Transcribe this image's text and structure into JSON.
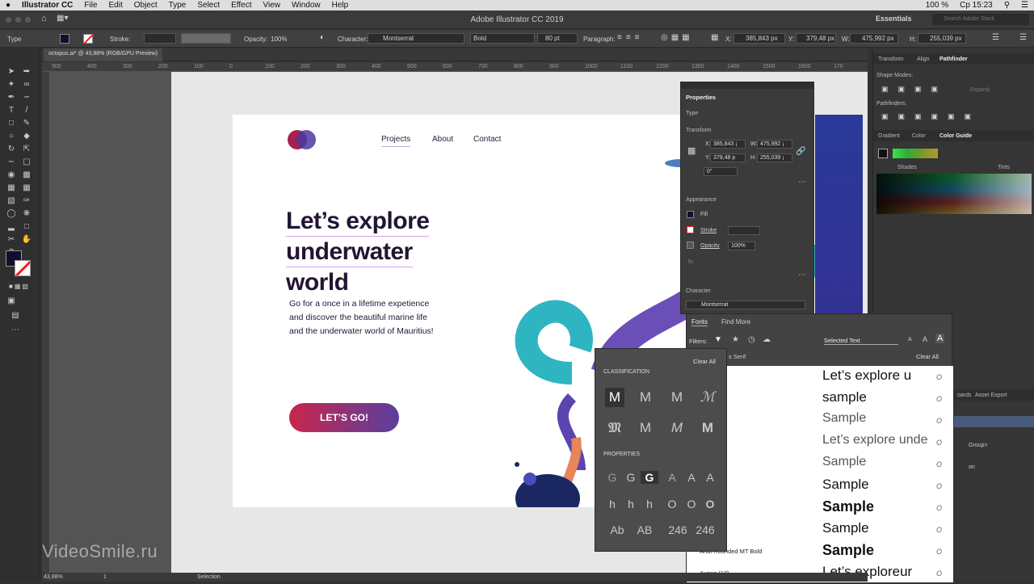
{
  "menubar": {
    "apple": "",
    "app": "Illustrator CC",
    "items": [
      "File",
      "Edit",
      "Object",
      "Type",
      "Select",
      "Effect",
      "View",
      "Window",
      "Help"
    ],
    "battery": "100 %",
    "clock": "Ср 15:23"
  },
  "window": {
    "title": "Adobe Illustrator CC 2019",
    "workspace": "Essentials",
    "search_placeholder": "Search Adobe Stock"
  },
  "control": {
    "tool": "Type",
    "stroke_label": "Stroke:",
    "opacity_label": "Opacity:",
    "opacity": "100%",
    "character_label": "Character:",
    "font": "Montserrat",
    "weight": "Bold",
    "size": "80 pt",
    "paragraph_label": "Paragraph:",
    "x_label": "X:",
    "x": "385,843 px",
    "y_label": "Y:",
    "y": "379,48 px",
    "w_label": "W:",
    "w": "475,992 px",
    "h_label": "H:",
    "h": "255,039 px"
  },
  "doc": {
    "tab": "octopus.ai* @ 43,88% (RGB/GPU Preview)",
    "ruler": [
      "500",
      "400",
      "300",
      "200",
      "100",
      "0",
      "100",
      "200",
      "300",
      "400",
      "500",
      "600",
      "700",
      "800",
      "900",
      "1000",
      "1100",
      "1200",
      "1300",
      "1400",
      "1500",
      "1600",
      "170"
    ]
  },
  "artboard": {
    "nav": [
      "Projects",
      "About",
      "Contact"
    ],
    "headline": [
      "Let’s explore",
      "underwater",
      "world"
    ],
    "body": [
      "Go for a once in a lifetime expetience",
      "and discover the beautiful marine life",
      "and the underwater world of Mauritius!"
    ],
    "cta": "LET’S GO!"
  },
  "properties": {
    "title": "Properties",
    "type": "Type",
    "transform": "Transform",
    "x_label": "X:",
    "x": "385,843 ¡",
    "y_label": "Y:",
    "y": "379,48 p",
    "w_label": "W:",
    "w": "475,992 ¡",
    "h_label": "H:",
    "h": "255,039 ¡",
    "angle": "0°",
    "appearance": "Appearance",
    "fill": "Fill",
    "stroke": "Stroke",
    "opacity_label": "Opacity",
    "opacity": "100%",
    "fx": "fx.",
    "character": "Character",
    "font": "Montserrat"
  },
  "fontpanel": {
    "tabs": [
      "Fonts",
      "Find More"
    ],
    "filters": "Filters:",
    "selected": "Selected Text",
    "clear_all": "Clear All",
    "clear_all_2": "Clear All",
    "header_partial": "s Serif",
    "rows": [
      {
        "name": "",
        "sample": "Let’s explore u",
        "style": "sans"
      },
      {
        "name": "",
        "sample": "sample",
        "style": "sans"
      },
      {
        "name": "8)",
        "sample": "Sample",
        "style": "light"
      },
      {
        "name": "Sans (14)",
        "sample": "Let’s explore unde",
        "style": "light"
      },
      {
        "name": "emix (10)",
        "sample": "Sample",
        "style": "light"
      },
      {
        "name": "",
        "sample": "Sample",
        "style": "sans"
      },
      {
        "name": "k",
        "sample": "Sample",
        "style": "black"
      },
      {
        "name": "row (4)",
        "sample": "Sample",
        "style": "narrow"
      },
      {
        "name": "Arial Rounded MT Bold",
        "sample": "Sample",
        "style": "bold"
      },
      {
        "name": "Avenir (12)",
        "sample": "Let’s exploreur",
        "style": "sans"
      }
    ]
  },
  "classify": {
    "clear": "Clear All",
    "classification": "CLASSIFICATION",
    "glyphs": [
      "M",
      "M",
      "M",
      "ℳ",
      "𝔐",
      "M",
      "M",
      "M"
    ],
    "properties": "PROPERTIES",
    "row1": [
      "G",
      "G",
      "G",
      "A",
      "A",
      "A"
    ],
    "row2": [
      "h",
      "h",
      "h",
      "O",
      "O",
      "O"
    ],
    "row3": [
      "Ab",
      "AB",
      "246",
      "246"
    ]
  },
  "rightpanel": {
    "tabs1": [
      "Transform",
      "Align",
      "Pathfinder"
    ],
    "shape_modes": "Shape Modes:",
    "pathfinders": "Pathfinders:",
    "expand": "Expand",
    "tabs2": [
      "Gradient",
      "Color",
      "Color Guide"
    ],
    "shades": "Shades",
    "tints": "Tints",
    "tabs3": [
      "oards",
      "Asset Export"
    ],
    "layers": [
      "Group>",
      "on"
    ]
  },
  "status": {
    "zoom": "43,88%",
    "page": "1",
    "mode": "Selection"
  },
  "watermark": "VideoSmile.ru",
  "colors": {
    "accent": "#c8264a",
    "purple": "#5a3fa0",
    "navy": "#221533",
    "teal": "#26b8c0"
  }
}
